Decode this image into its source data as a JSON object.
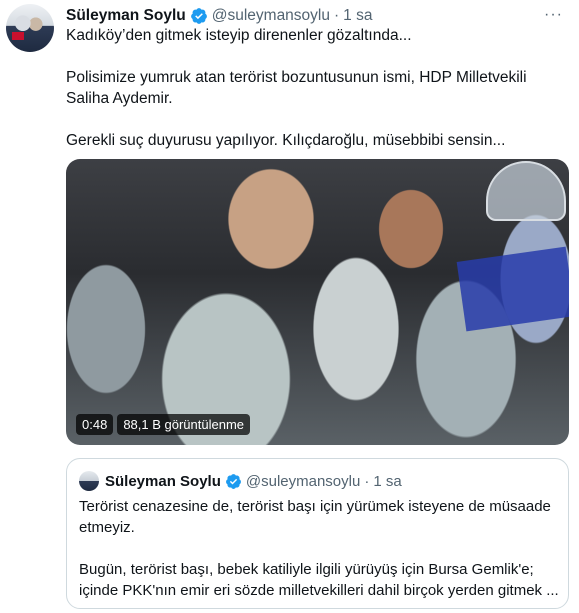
{
  "tweet": {
    "author_name": "Süleyman Soylu",
    "handle": "@suleymansoylu",
    "separator": "·",
    "time": "1 sa",
    "more": "···",
    "paragraphs": [
      "Kadıköy’den gitmek isteyip direnenler gözaltında...",
      "Polisimize yumruk atan terörist bozuntusunun ismi, HDP Milletvekili Saliha Aydemir.",
      "Gerekli suç duyurusu yapılıyor. Kılıçdaroğlu, müsebbibi sensin..."
    ],
    "video": {
      "duration": "0:48",
      "views": "88,1 B görüntülenme"
    }
  },
  "quoted": {
    "author_name": "Süleyman Soylu",
    "handle": "@suleymansoylu",
    "separator": "·",
    "time": "1 sa",
    "lines": [
      "Terörist cenazesine de, terörist başı için yürümek isteyene de müsaade",
      "etmeyiz.",
      "Bugün, terörist başı, bebek katiliyle ilgili yürüyüş için Bursa Gemlik'e;",
      "içinde PKK'nın emir eri sözde milletvekilleri dahil birçok yerden gitmek ..."
    ]
  },
  "colors": {
    "verified_blue": "#1d9bf0",
    "secondary_text": "#536471",
    "border": "#cfd9de"
  },
  "icons": [
    "verified-badge-icon",
    "more-options-icon"
  ]
}
